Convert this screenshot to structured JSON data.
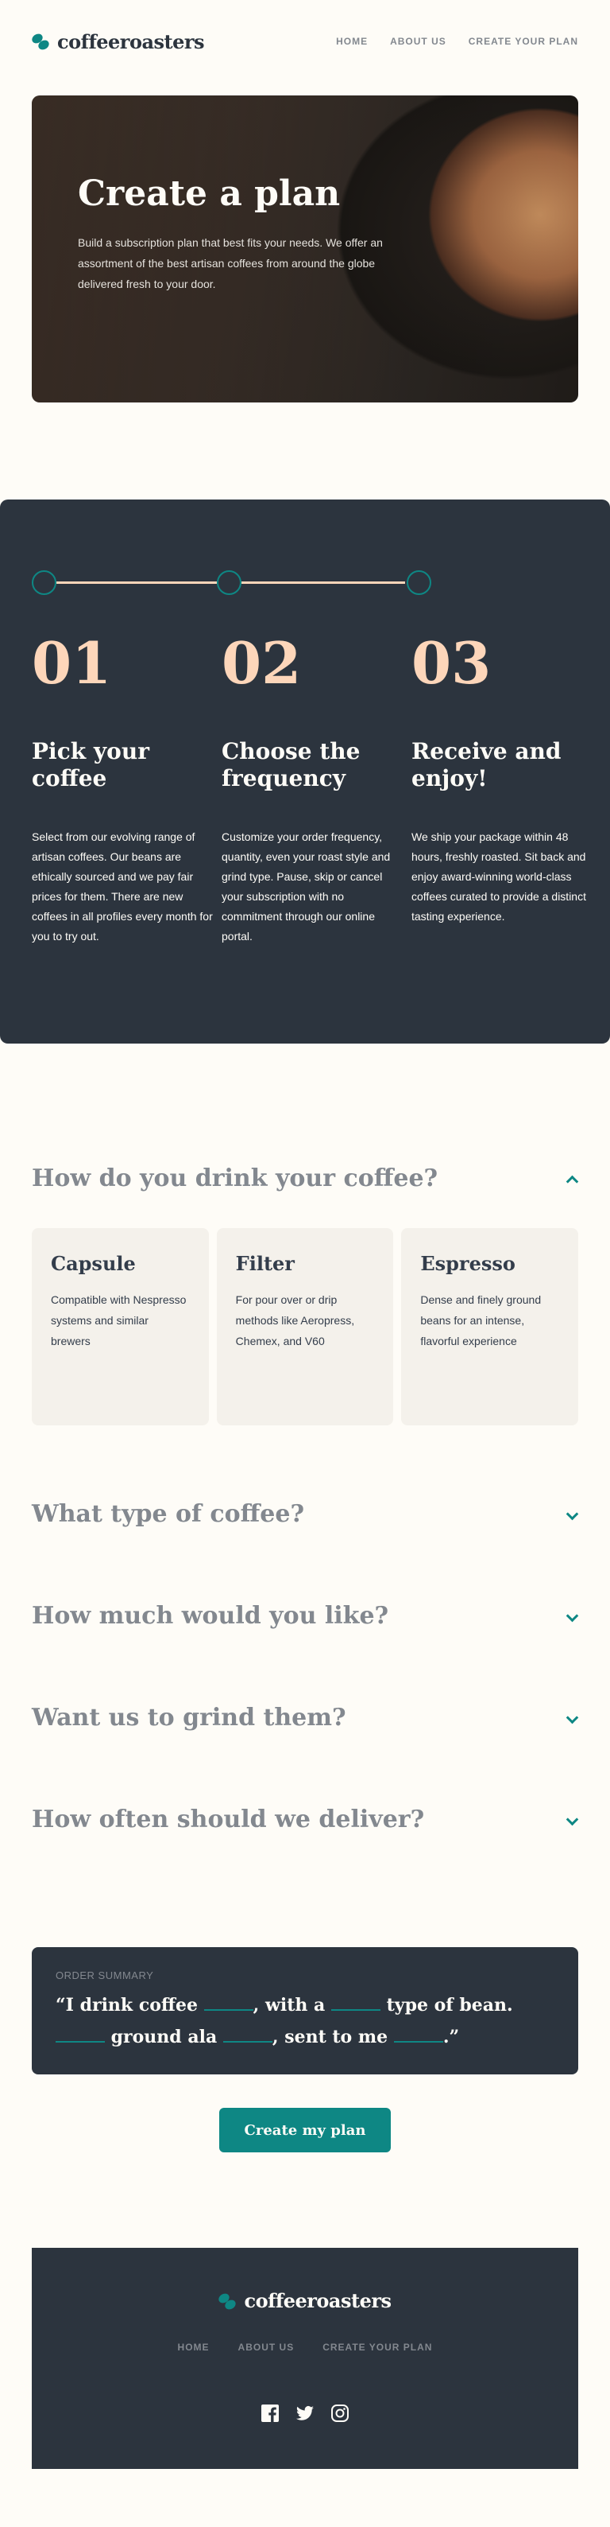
{
  "header": {
    "logo_text": "coffeeroasters",
    "nav": [
      "HOME",
      "ABOUT US",
      "CREATE YOUR PLAN"
    ]
  },
  "hero": {
    "title": "Create a plan",
    "text": "Build a subscription plan that best fits your needs. We offer an assortment of the best artisan coffees from around the globe delivered fresh to your door."
  },
  "steps": [
    {
      "num": "01",
      "title": "Pick your coffee",
      "text": "Select from our evolving range of artisan coffees. Our beans are ethically sourced and we pay fair prices for them. There are new coffees in all profiles every month for you to try out."
    },
    {
      "num": "02",
      "title": "Choose the frequency",
      "text": "Customize your order frequency, quantity, even your roast style and grind type. Pause, skip or cancel your subscription with no commitment through our online portal."
    },
    {
      "num": "03",
      "title": "Receive and enjoy!",
      "text": "We ship your package within 48 hours, freshly roasted. Sit back and enjoy award-winning world-class coffees curated to provide a distinct tasting experience."
    }
  ],
  "questions": [
    {
      "title": "How do you drink your coffee?",
      "expanded": true
    },
    {
      "title": "What type of coffee?",
      "expanded": false
    },
    {
      "title": "How much would you like?",
      "expanded": false
    },
    {
      "title": "Want us to grind them?",
      "expanded": false
    },
    {
      "title": "How often should we deliver?",
      "expanded": false
    }
  ],
  "drink_options": [
    {
      "title": "Capsule",
      "text": "Compatible with Nespresso systems and similar brewers"
    },
    {
      "title": "Filter",
      "text": "For pour over or drip methods like Aeropress, Chemex, and V60"
    },
    {
      "title": "Espresso",
      "text": "Dense and finely ground beans for an intense, flavorful experience"
    }
  ],
  "summary": {
    "label": "ORDER SUMMARY",
    "part1": "“I drink coffee ",
    "part2": ", with a ",
    "part3": " type of bean. ",
    "part4": " ground ala ",
    "part5": ", sent to me ",
    "part6": ".”"
  },
  "create_button": "Create my plan",
  "footer": {
    "logo_text": "coffeeroasters",
    "nav": [
      "HOME",
      "ABOUT US",
      "CREATE YOUR PLAN"
    ],
    "social_icons": [
      "facebook-icon",
      "twitter-icon",
      "instagram-icon"
    ]
  },
  "colors": {
    "accent": "#0e8784",
    "dark": "#2c343e",
    "peach": "#fdd6ba",
    "cream": "#fefcf7"
  }
}
